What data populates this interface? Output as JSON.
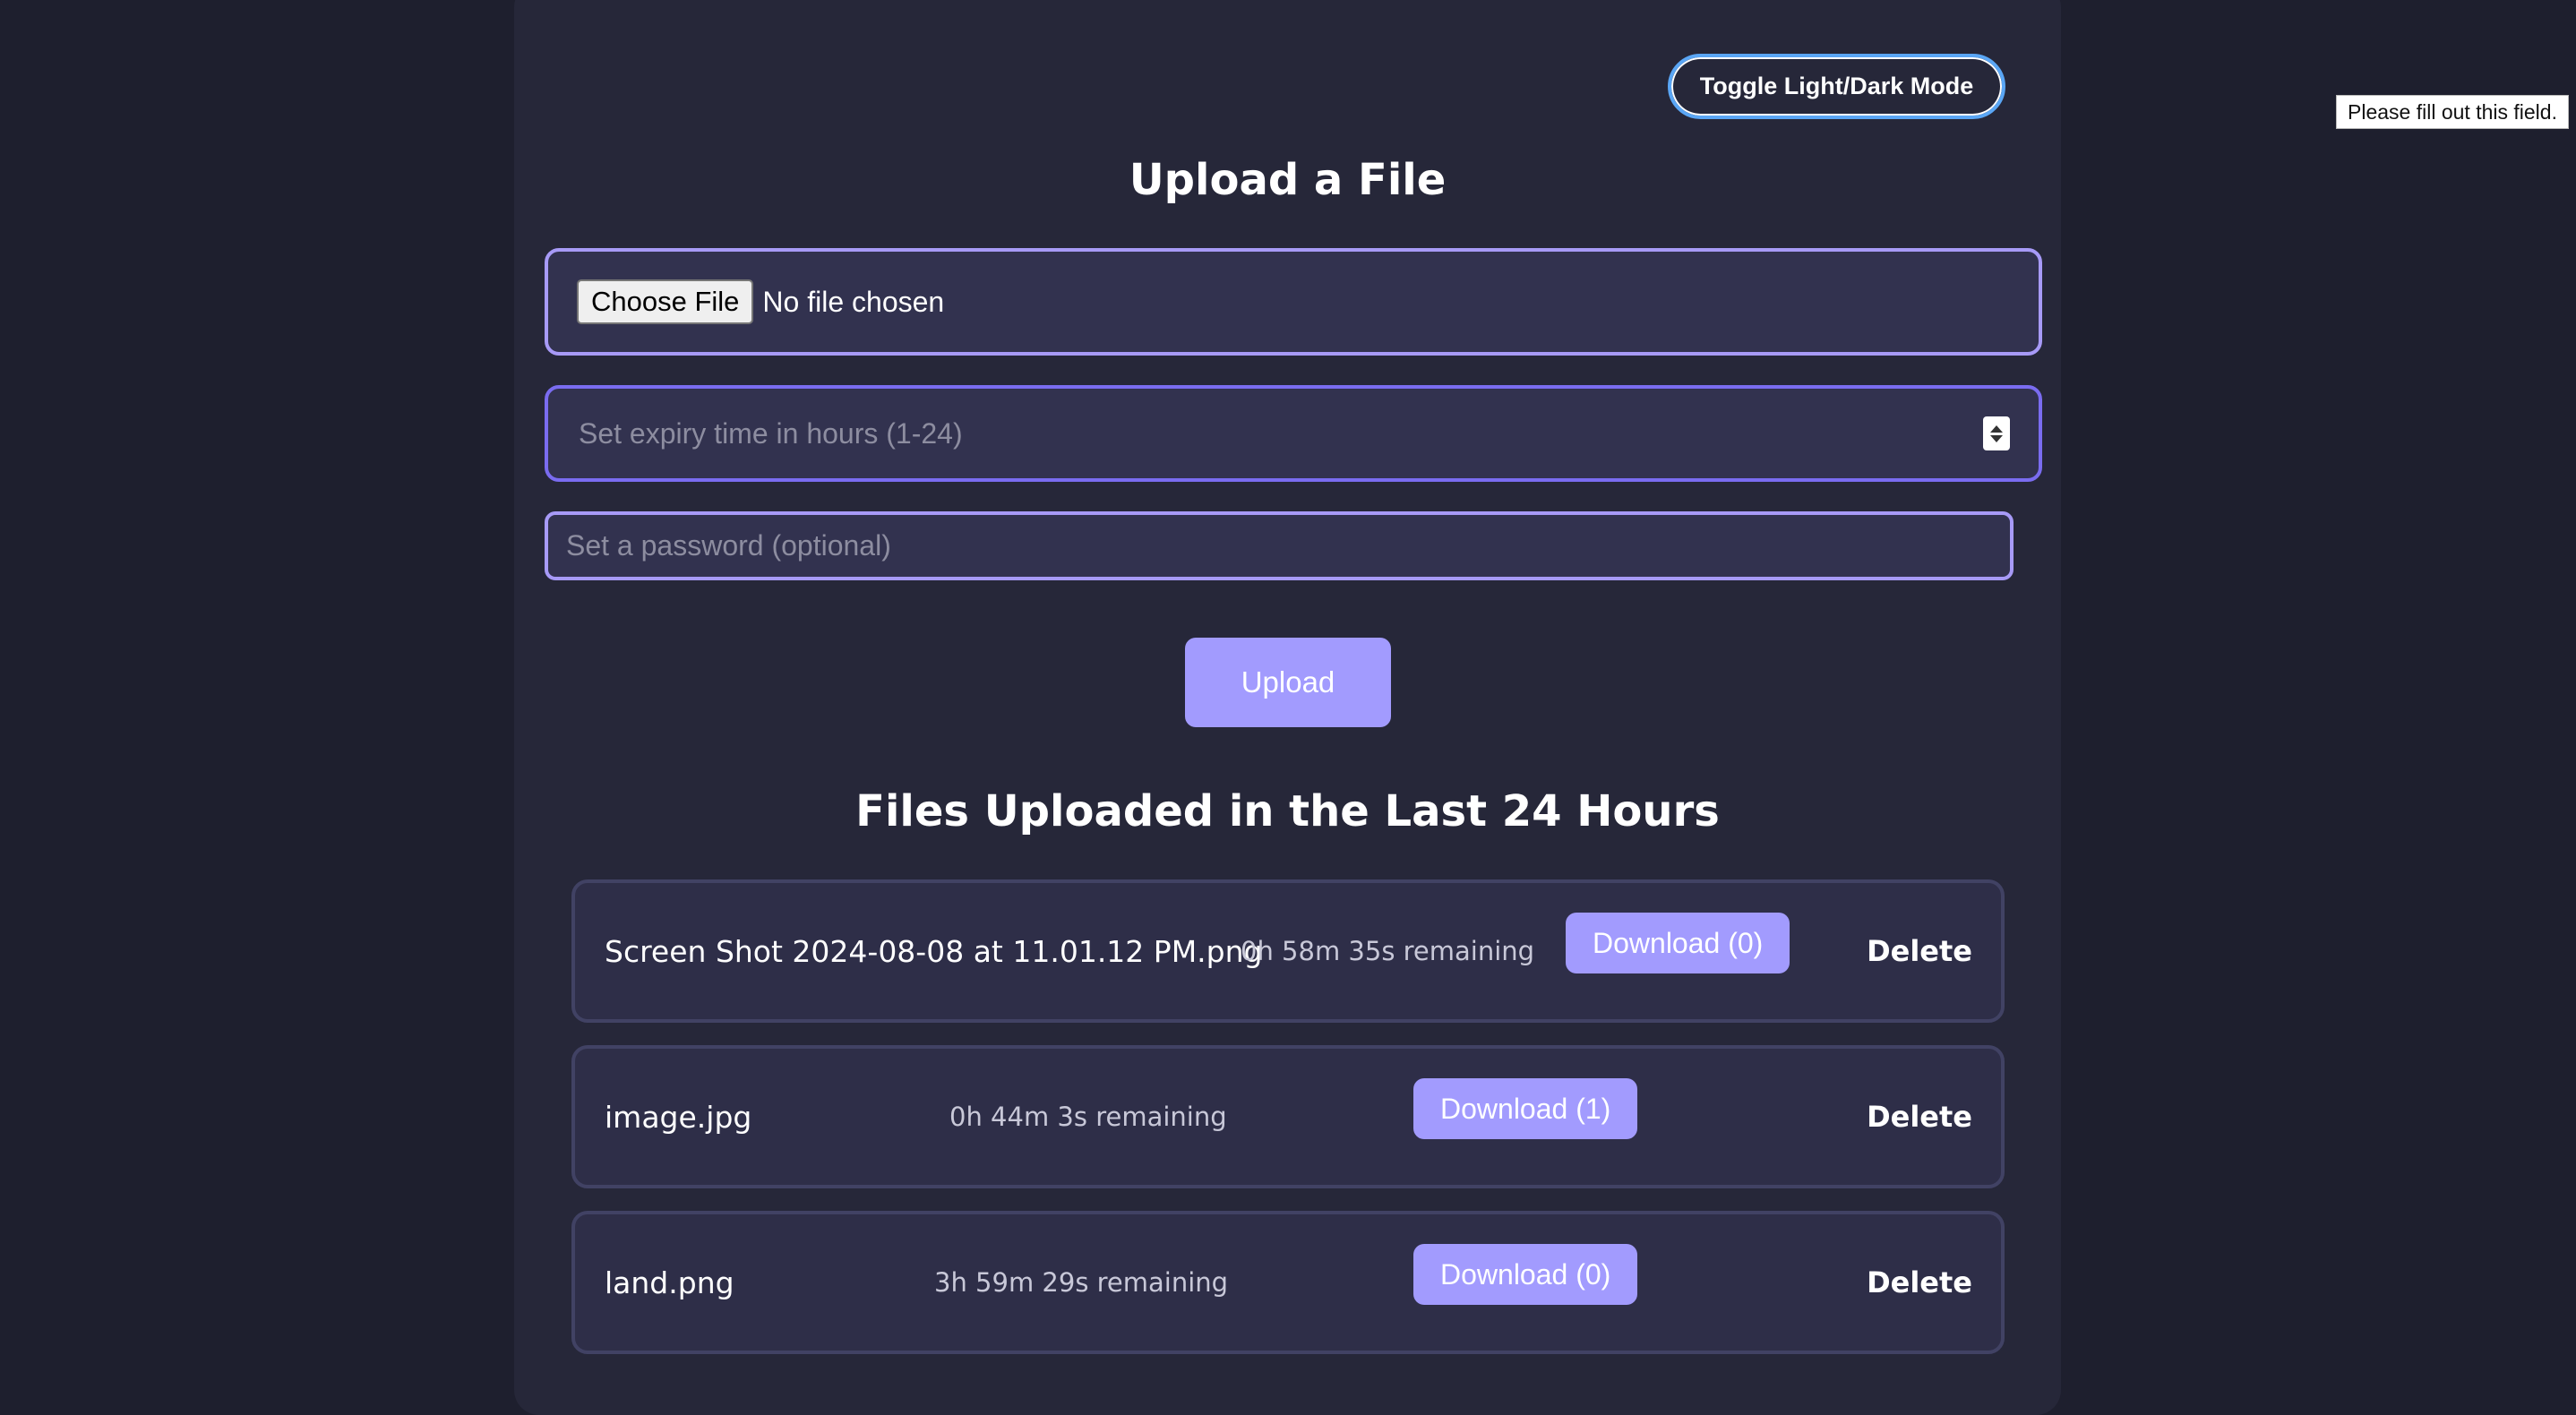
{
  "header": {
    "toggle_label": "Toggle Light/Dark Mode"
  },
  "tooltip": {
    "text": "Please fill out this field."
  },
  "upload_form": {
    "title": "Upload a File",
    "choose_file_label": "Choose File",
    "no_file_text": "No file chosen",
    "expiry_placeholder": "Set expiry time in hours (1-24)",
    "expiry_value": "",
    "password_placeholder": "Set a password (optional)",
    "password_value": "",
    "upload_label": "Upload"
  },
  "files_section": {
    "title": "Files Uploaded in the Last 24 Hours",
    "delete_label": "Delete",
    "files": [
      {
        "name": "Screen Shot 2024-08-08 at 11.01.12 PM.png",
        "remaining": "0h 58m 35s remaining",
        "download_label": "Download (0)"
      },
      {
        "name": "image.jpg",
        "remaining": "0h 44m 3s remaining",
        "download_label": "Download (1)"
      },
      {
        "name": "land.png",
        "remaining": "3h 59m 29s remaining",
        "download_label": "Download (0)"
      }
    ]
  },
  "colors": {
    "background": "#1e1f2e",
    "panel": "#262739",
    "accent": "#a29bfe",
    "input_border": "#8b7df0"
  }
}
